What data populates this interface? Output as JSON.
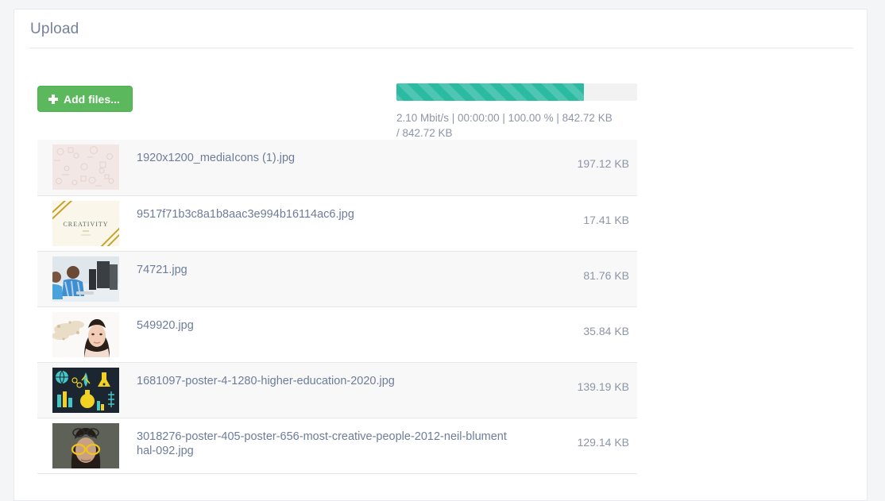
{
  "panel": {
    "title": "Upload"
  },
  "toolbar": {
    "add_files_label": "Add files...",
    "plus_icon": "plus-icon"
  },
  "progress": {
    "percent": 100,
    "fill_ratio": 78,
    "bar_color": "#2bbba3",
    "track_color": "#f2f2f2",
    "status": "2.10 Mbit/s | 00:00:00 | 100.00 % | 842.72 KB / 842.72 KB",
    "speed": "2.10 Mbit/s",
    "elapsed": "00:00:00",
    "percent_label": "100.00 %",
    "uploaded": "842.72 KB",
    "total": "842.72 KB"
  },
  "files": [
    {
      "name": "1920x1200_mediaIcons (1).jpg",
      "size": "197.12 KB",
      "thumb": "pale-pink-pattern-thumbnail"
    },
    {
      "name": "9517f71b3c8a1b8aac3e994b16114ac6.jpg",
      "size": "17.41 KB",
      "thumb": "creativity-card-thumbnail"
    },
    {
      "name": "74721.jpg",
      "size": "81.76 KB",
      "thumb": "kids-at-computers-thumbnail"
    },
    {
      "name": "549920.jpg",
      "size": "35.84 KB",
      "thumb": "woman-portrait-thumbnail"
    },
    {
      "name": "1681097-poster-4-1280-higher-education-2020.jpg",
      "size": "139.19 KB",
      "thumb": "education-icons-poster-thumbnail"
    },
    {
      "name": "3018276-poster-405-poster-656-most-creative-people-2012-neil-blumenthal-092.jpg",
      "size": "129.14 KB",
      "thumb": "man-yellow-glasses-thumbnail"
    }
  ],
  "colors": {
    "page_background": "#f4f5f6",
    "panel_background": "#ffffff",
    "accent_green": "#5cb85c",
    "accent_teal": "#2bbba3",
    "title_text": "#76819a",
    "link_text": "#6d7d99",
    "muted_text": "#8c95a8"
  }
}
